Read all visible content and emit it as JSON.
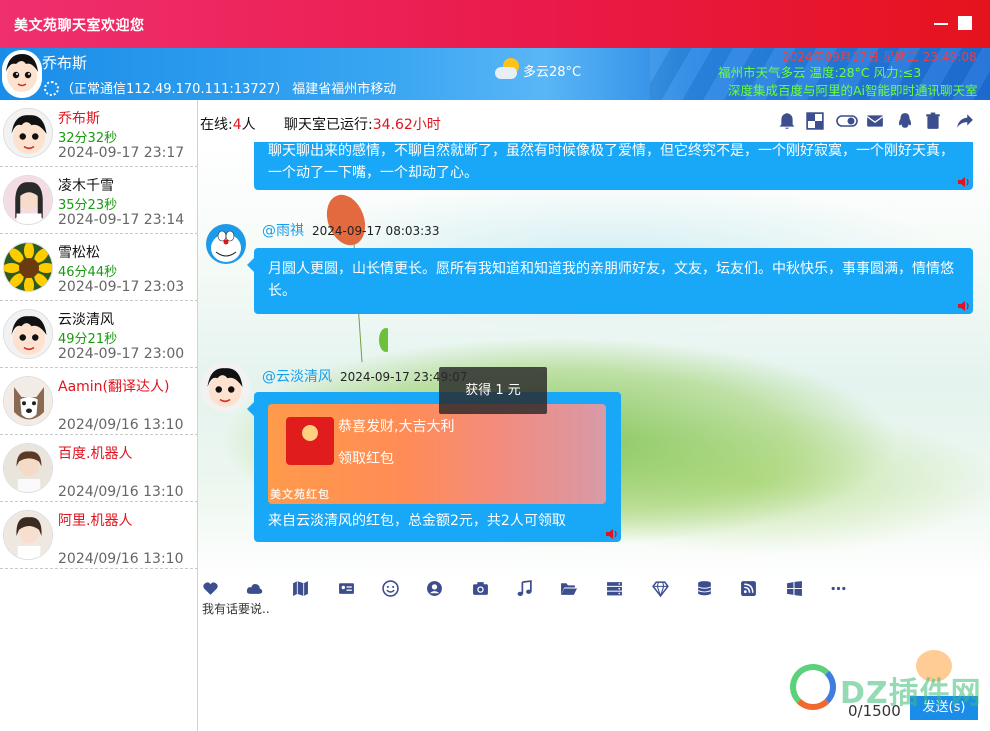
{
  "window": {
    "title": "美文苑聊天室欢迎您"
  },
  "header": {
    "username": "乔布斯",
    "status": "正常通信112.49.170.111:13727） 福建省福州市移动",
    "weather": "多云28°C",
    "marquee_top": "2024年09月17日 星期二 23:49:08",
    "marquee_mid": "福州市天气多云 温度:28°C 风力:≤3",
    "marquee_bottom": "深度集成百度与阿里的Ai智能即时通讯聊天室"
  },
  "toolbar": {
    "online_label": "在线:",
    "online_count": "4",
    "online_unit": "人",
    "runtime_label": "聊天室已运行:",
    "runtime_value": "34.62小时"
  },
  "users": [
    {
      "name": "乔布斯",
      "duration": "32分32秒",
      "time": "2024-09-17 23:17",
      "name_red": true,
      "avatar": "cartoon-boy"
    },
    {
      "name": "凌木千雪",
      "duration": "35分23秒",
      "time": "2024-09-17 23:14",
      "name_red": false,
      "avatar": "girl-photo"
    },
    {
      "name": "雪松松",
      "duration": "46分44秒",
      "time": "2024-09-17 23:03",
      "name_red": false,
      "avatar": "sunflower"
    },
    {
      "name": "云淡清风",
      "duration": "49分21秒",
      "time": "2024-09-17 23:00",
      "name_red": false,
      "avatar": "cartoon-boy"
    },
    {
      "name": "Aamin(翻译达人)",
      "duration": "",
      "time": "2024/09/16 13:10",
      "name_red": true,
      "avatar": "husky"
    },
    {
      "name": "百度.机器人",
      "duration": "",
      "time": "2024/09/16 13:10",
      "name_red": true,
      "avatar": "girl-photo"
    },
    {
      "name": "阿里.机器人",
      "duration": "",
      "time": "2024/09/16 13:10",
      "name_red": true,
      "avatar": "girl-photo"
    }
  ],
  "messages": [
    {
      "text": "聊天聊出来的感情，不聊自然就断了，虽然有时候像极了爱情，但它终究不是，一个刚好寂寞，一个刚好天真，一个动了一下嘴，一个却动了心。"
    },
    {
      "sender": "@雨祺",
      "time": "2024-09-17 08:03:33",
      "text": "月圆人更圆，山长情更长。愿所有我知道和知道我的亲朋师好友，文友，坛友们。中秋快乐，事事圆满，情情悠长。"
    },
    {
      "sender": "@云淡清风",
      "time": "2024-09-17 23:49:07",
      "redpacket": {
        "wish": "恭喜发财,大吉大利",
        "action": "领取红包",
        "brand": "美文苑红包"
      },
      "text": "来自云淡清风的红包，总金额2元，共2人可领取"
    }
  ],
  "toast": "获得 1 元",
  "input": {
    "placeholder": "我有话要说..",
    "counter": "0/1500",
    "send_label": "发送(s)"
  },
  "watermark": "DZ插件网",
  "colors": {
    "title_bar": "#ea1a4a",
    "header": "#1a8de8",
    "bubble": "#19a8f7",
    "accent_red": "#e0141e",
    "duration_green": "#1a9a12"
  }
}
